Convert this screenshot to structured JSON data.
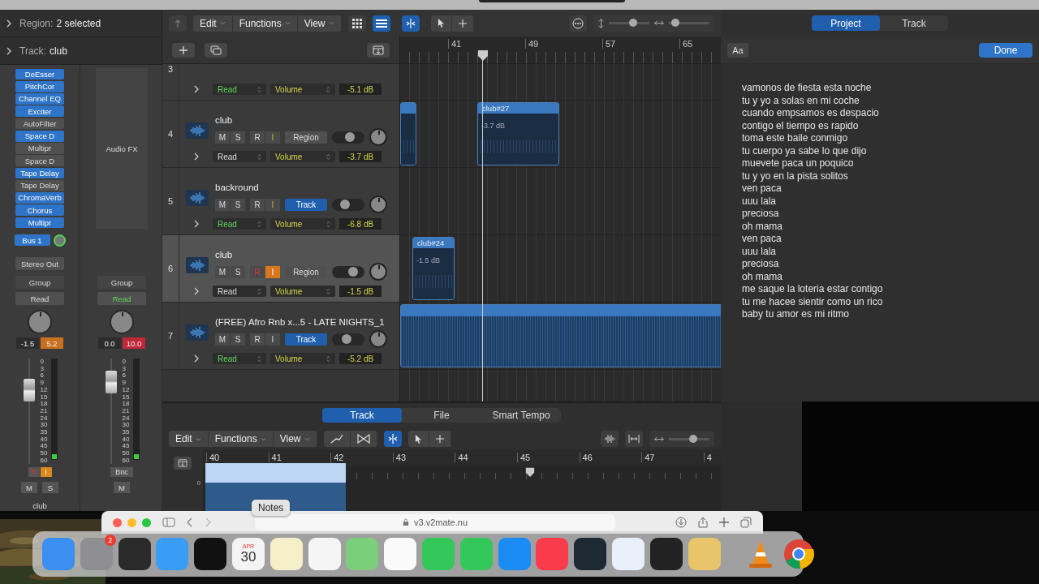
{
  "inspector": {
    "region": {
      "label": "Region:",
      "value": "2 selected"
    },
    "track": {
      "label": "Track:",
      "value": "club"
    },
    "strips": [
      {
        "kind": "track",
        "plugins": [
          {
            "name": "DeEsser",
            "on": true
          },
          {
            "name": "PitchCor",
            "on": true
          },
          {
            "name": "Channel EQ",
            "on": true
          },
          {
            "name": "Exciter",
            "on": true
          },
          {
            "name": "AutoFilter",
            "on": false
          },
          {
            "name": "Space D",
            "on": true
          },
          {
            "name": "Multipr",
            "on": false
          },
          {
            "name": "Space D",
            "on": false
          },
          {
            "name": "Tape Delay",
            "on": true
          },
          {
            "name": "Tape Delay",
            "on": false
          },
          {
            "name": "ChromaVerb",
            "on": true
          },
          {
            "name": "Chorus",
            "on": true
          },
          {
            "name": "Multipr",
            "on": true
          }
        ],
        "send": "Bus 1",
        "output": "Stereo Out",
        "group": "Group",
        "automation": {
          "label": "Read",
          "on": false
        },
        "pan_value": "-1.5",
        "peak": {
          "value": "5.2",
          "color": "#c8701e"
        },
        "fader": {
          "level": 0.7
        },
        "scale": [
          "0",
          "3",
          "6",
          "9",
          "12",
          "15",
          "18",
          "21",
          "24",
          "30",
          "35",
          "40",
          "45",
          "50",
          "60"
        ],
        "record": {
          "label": "R",
          "on": true
        },
        "input": {
          "label": "I",
          "on": true
        },
        "mute": "M",
        "solo": "S",
        "name": "club"
      },
      {
        "kind": "output",
        "slot": "Audio FX",
        "group": "Group",
        "automation": {
          "label": "Read",
          "on": true
        },
        "pan_value": "0.0",
        "peak": {
          "value": "10.0",
          "color": "#c0283a"
        },
        "fader": {
          "level": 0.78
        },
        "scale": [
          "0",
          "3",
          "6",
          "9",
          "12",
          "15",
          "18",
          "21",
          "24",
          "30",
          "35",
          "40",
          "45",
          "50",
          "60"
        ],
        "bounce": "Bnc",
        "mute": "M"
      }
    ]
  },
  "toolbar": {
    "menus": [
      "Edit",
      "Functions",
      "View"
    ],
    "vertical_zoom": {
      "level": 0.6
    },
    "horizontal_zoom": {
      "level": 0.15
    }
  },
  "ruler": [
    "41",
    "49",
    "57",
    "65"
  ],
  "tracks": [
    {
      "kind": "partial",
      "number": "3",
      "automation": {
        "label": "Read",
        "on": true
      },
      "parameter": "Volume",
      "value": "-5.1 dB"
    },
    {
      "kind": "full",
      "number": "4",
      "name": "club",
      "selected": false,
      "mute": "M",
      "solo": "S",
      "record": {
        "label": "R",
        "on": false
      },
      "input": {
        "label": "I",
        "on": false,
        "auto": true
      },
      "mode": {
        "label": "Region",
        "on": false
      },
      "volume": {
        "level": 0.55
      },
      "automation": {
        "label": "Read",
        "on": false
      },
      "parameter": "Volume",
      "value": "-3.7 dB",
      "regions": [
        {
          "kind": "cut"
        },
        {
          "kind": "named",
          "name": "club#27",
          "gain": "-3.7 dB"
        }
      ]
    },
    {
      "kind": "full",
      "number": "5",
      "name": "backround",
      "selected": false,
      "mute": "M",
      "solo": "S",
      "record": {
        "label": "R",
        "on": false
      },
      "input": {
        "label": "I",
        "on": false,
        "auto": true
      },
      "mode": {
        "label": "Track",
        "on": true
      },
      "volume": {
        "level": 0.4
      },
      "automation": {
        "label": "Read",
        "on": true
      },
      "parameter": "Volume",
      "value": "-6.8 dB"
    },
    {
      "kind": "full",
      "number": "6",
      "name": "club",
      "selected": true,
      "mute": "M",
      "solo": "S",
      "record": {
        "label": "R",
        "on": true
      },
      "input": {
        "label": "I",
        "on": true,
        "auto": false
      },
      "mode": {
        "label": "Region",
        "on": false
      },
      "volume": {
        "level": 0.65
      },
      "automation": {
        "label": "Read",
        "on": false
      },
      "parameter": "Volume",
      "value": "-1.5 dB",
      "regions": [
        {
          "kind": "named",
          "name": "club#24",
          "gain": "-1.5 dB"
        }
      ]
    },
    {
      "kind": "full",
      "number": "7",
      "name": "(FREE) Afro Rnb x...5 - LATE NIGHTS_1",
      "selected": false,
      "mute": "M",
      "solo": "S",
      "record": {
        "label": "R",
        "on": false
      },
      "input": {
        "label": "I",
        "on": false,
        "auto": false
      },
      "mode": {
        "label": "Track",
        "on": true
      },
      "volume": {
        "level": 0.45
      },
      "automation": {
        "label": "Read",
        "on": true
      },
      "parameter": "Volume",
      "value": "-5.2 dB",
      "regions": [
        {
          "kind": "long"
        }
      ]
    }
  ],
  "editor": {
    "tabs": [
      {
        "label": "Track",
        "selected": true
      },
      {
        "label": "File",
        "selected": false
      },
      {
        "label": "Smart Tempo",
        "selected": false
      }
    ],
    "menus": [
      "Edit",
      "Functions",
      "View"
    ],
    "zoom": {
      "level": 0.6
    },
    "ruler": [
      "40",
      "41",
      "42",
      "43",
      "44",
      "45",
      "46",
      "47",
      "4"
    ],
    "axis": "0"
  },
  "notes": {
    "tabs": [
      {
        "label": "Project",
        "selected": true
      },
      {
        "label": "Track",
        "selected": false
      }
    ],
    "font_button": "Aa",
    "done": "Done",
    "lines": [
      "vamonos de fiesta esta noche",
      "tu y yo a solas en mi coche",
      "cuando empsamos es despacio",
      "contigo el tiempo es rapido",
      "toma este baile conmigo",
      "tu cuerpo ya sabe lo que dijo",
      "muevete paca un poquico",
      "tu y yo en la pista solitos",
      "ven paca",
      "uuu lala",
      "preciosa",
      "oh mama",
      "ven paca",
      "uuu lala",
      "preciosa",
      "oh mama",
      "me saque la loteria estar contigo",
      "tu me hacee sientir como un rico",
      "baby tu amor es mi ritmo"
    ]
  },
  "browser": {
    "tooltip": "Notes",
    "url": "v3.v2mate.nu"
  },
  "dock": {
    "badge": "2",
    "calendar": {
      "month": "APR",
      "day": "30"
    }
  }
}
